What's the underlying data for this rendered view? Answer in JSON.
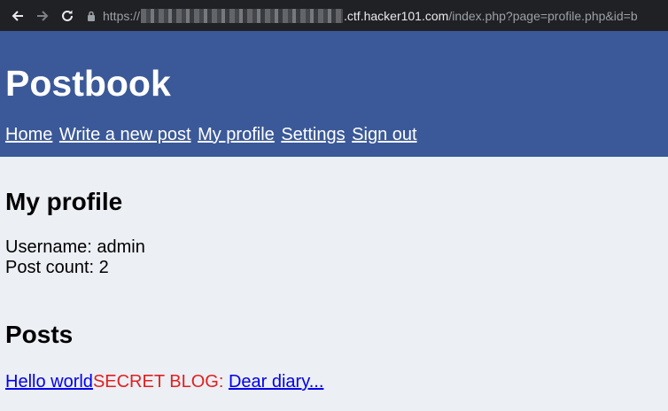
{
  "browser": {
    "url_prefix": "https://",
    "url_host": ".ctf.hacker101.com",
    "url_path": "/index.php?page=profile.php&id=b"
  },
  "header": {
    "title": "Postbook",
    "nav": [
      "Home",
      "Write a new post",
      "My profile",
      "Settings",
      "Sign out"
    ]
  },
  "profile": {
    "heading": "My profile",
    "username_line": "Username: admin",
    "postcount_line": "Post count: 2"
  },
  "posts": {
    "heading": "Posts",
    "items": [
      {
        "link": "Hello world",
        "prefix": ""
      },
      {
        "link": "Dear diary...",
        "prefix": "SECRET BLOG: "
      }
    ]
  },
  "colors": {
    "header_bg": "#3b5998",
    "page_bg": "#eceff4",
    "link": "#0000ee",
    "secret": "#e02020"
  }
}
